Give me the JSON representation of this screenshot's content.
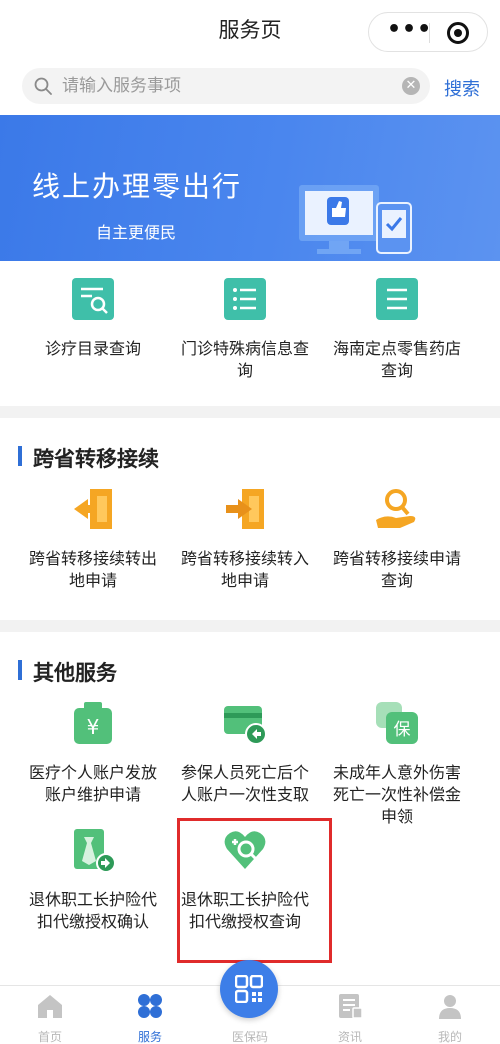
{
  "header": {
    "title": "服务页"
  },
  "search": {
    "placeholder": "请输入服务事项",
    "button": "搜索"
  },
  "banner": {
    "title": "线上办理零出行",
    "subtitle": "自主更便民"
  },
  "quick_services": [
    {
      "label": "诊疗目录查询",
      "icon": "document-search-icon"
    },
    {
      "label": "门诊特殊病信息查询",
      "icon": "list-icon"
    },
    {
      "label": "海南定点零售药店查询",
      "icon": "document-lines-icon"
    }
  ],
  "transfer": {
    "title": "跨省转移接续",
    "items": [
      {
        "label": "跨省转移接续转出地申请",
        "icon": "door-exit-icon"
      },
      {
        "label": "跨省转移接续转入地申请",
        "icon": "door-enter-icon"
      },
      {
        "label": "跨省转移接续申请查询",
        "icon": "hand-search-icon"
      }
    ]
  },
  "other": {
    "title": "其他服务",
    "items": [
      {
        "label": "医疗个人账户发放账户维护申请",
        "icon": "yuan-bag-icon"
      },
      {
        "label": "参保人员死亡后个人账户一次性支取",
        "icon": "card-return-icon"
      },
      {
        "label": "未成年人意外伤害死亡一次性补偿金申领",
        "icon": "protect-icon"
      },
      {
        "label": "退休职工长护险代扣代缴授权确认",
        "icon": "clipboard-arrow-icon"
      },
      {
        "label": "退休职工长护险代扣代缴授权查询",
        "icon": "heart-search-icon"
      }
    ]
  },
  "tabbar": {
    "items": [
      {
        "label": "首页",
        "icon": "home-icon"
      },
      {
        "label": "服务",
        "icon": "grid-icon",
        "active": true
      },
      {
        "label": "医保码",
        "icon": "qr-code-icon"
      },
      {
        "label": "资讯",
        "icon": "news-icon"
      },
      {
        "label": "我的",
        "icon": "user-icon"
      }
    ]
  },
  "colors": {
    "accent": "#2f6fd6",
    "teal": "#3fbfa9",
    "orange": "#f5a623",
    "green": "#52c07a",
    "highlight": "#e02b2b"
  }
}
